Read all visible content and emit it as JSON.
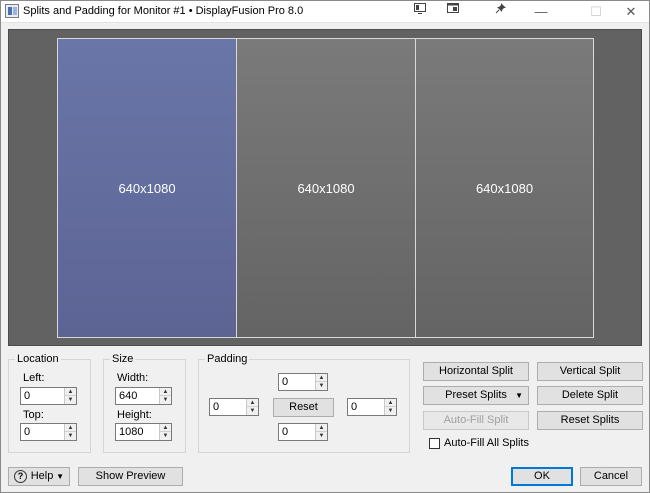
{
  "window": {
    "title": "Splits and Padding for Monitor #1 • DisplayFusion Pro 8.0",
    "controls": {
      "minimize": "—",
      "maximize": "☐",
      "close": "✕"
    }
  },
  "preview": {
    "splits": [
      {
        "label": "640x1080",
        "selected": true
      },
      {
        "label": "640x1080",
        "selected": false
      },
      {
        "label": "640x1080",
        "selected": false
      }
    ]
  },
  "location": {
    "title": "Location",
    "left_label": "Left:",
    "left_value": "0",
    "top_label": "Top:",
    "top_value": "0"
  },
  "size": {
    "title": "Size",
    "width_label": "Width:",
    "width_value": "640",
    "height_label": "Height:",
    "height_value": "1080"
  },
  "padding": {
    "title": "Padding",
    "top_value": "0",
    "left_value": "0",
    "right_value": "0",
    "bottom_value": "0",
    "reset_label": "Reset"
  },
  "actions": {
    "horizontal_split": "Horizontal Split",
    "vertical_split": "Vertical Split",
    "preset_splits": "Preset Splits",
    "delete_split": "Delete Split",
    "auto_fill_split": "Auto-Fill Split",
    "reset_splits": "Reset Splits",
    "auto_fill_all_label": "Auto-Fill All Splits"
  },
  "footer": {
    "help": "Help",
    "show_preview": "Show Preview",
    "ok": "OK",
    "cancel": "Cancel"
  },
  "colors": {
    "selected_split": "#6a76a8",
    "split": "#707070",
    "preview_bg": "#626262",
    "default_button_border": "#0078d7"
  }
}
